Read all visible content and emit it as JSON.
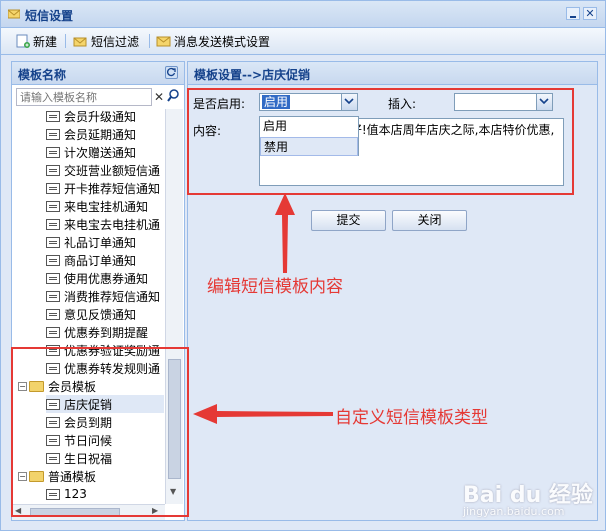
{
  "window": {
    "title": "短信设置"
  },
  "toolbar": {
    "new_label": "新建",
    "filter_label": "短信过滤",
    "mode_label": "消息发送模式设置"
  },
  "left_panel": {
    "title": "模板名称",
    "search_placeholder": "请输入模板名称",
    "tree": [
      {
        "label": "会员升级通知",
        "type": "doc",
        "level": 2
      },
      {
        "label": "会员延期通知",
        "type": "doc",
        "level": 2
      },
      {
        "label": "计次赠送通知",
        "type": "doc",
        "level": 2
      },
      {
        "label": "交班营业额短信通",
        "type": "doc",
        "level": 2
      },
      {
        "label": "开卡推荐短信通知",
        "type": "doc",
        "level": 2
      },
      {
        "label": "来电宝挂机通知",
        "type": "doc",
        "level": 2
      },
      {
        "label": "来电宝去电挂机通",
        "type": "doc",
        "level": 2
      },
      {
        "label": "礼品订单通知",
        "type": "doc",
        "level": 2
      },
      {
        "label": "商品订单通知",
        "type": "doc",
        "level": 2
      },
      {
        "label": "使用优惠券通知",
        "type": "doc",
        "level": 2
      },
      {
        "label": "消费推荐短信通知",
        "type": "doc",
        "level": 2
      },
      {
        "label": "意见反馈通知",
        "type": "doc",
        "level": 2
      },
      {
        "label": "优惠券到期提醒",
        "type": "doc",
        "level": 2
      },
      {
        "label": "优惠券验证奖励通",
        "type": "doc",
        "level": 2
      },
      {
        "label": "优惠券转发规则通",
        "type": "doc",
        "level": 2
      },
      {
        "label": "会员模板",
        "type": "folder",
        "level": 1
      },
      {
        "label": "店庆促销",
        "type": "doc",
        "level": 2,
        "selected": true
      },
      {
        "label": "会员到期",
        "type": "doc",
        "level": 2
      },
      {
        "label": "节日问候",
        "type": "doc",
        "level": 2
      },
      {
        "label": "生日祝福",
        "type": "doc",
        "level": 2
      },
      {
        "label": "普通模板",
        "type": "folder",
        "level": 1
      },
      {
        "label": "123",
        "type": "doc",
        "level": 2
      }
    ]
  },
  "right_panel": {
    "title": "模板设置-->店庆促销",
    "enable_label": "是否启用:",
    "enable_value": "启用",
    "enable_options": [
      "启用",
      "禁用"
    ],
    "insert_label": "插入:",
    "insert_value": "",
    "content_label": "内容:",
    "content_text": "【#会员名】,您好!值本店周年店庆之际,本店特价优惠,欢迎惠顾!",
    "submit_label": "提交",
    "close_label": "关闭"
  },
  "annotations": {
    "edit_note": "编辑短信模板内容",
    "custom_note": "自定义短信模板类型",
    "color": "#e53935"
  },
  "watermark": {
    "text": "Bai du 经验",
    "sub": "jingyan.baidu.com"
  }
}
